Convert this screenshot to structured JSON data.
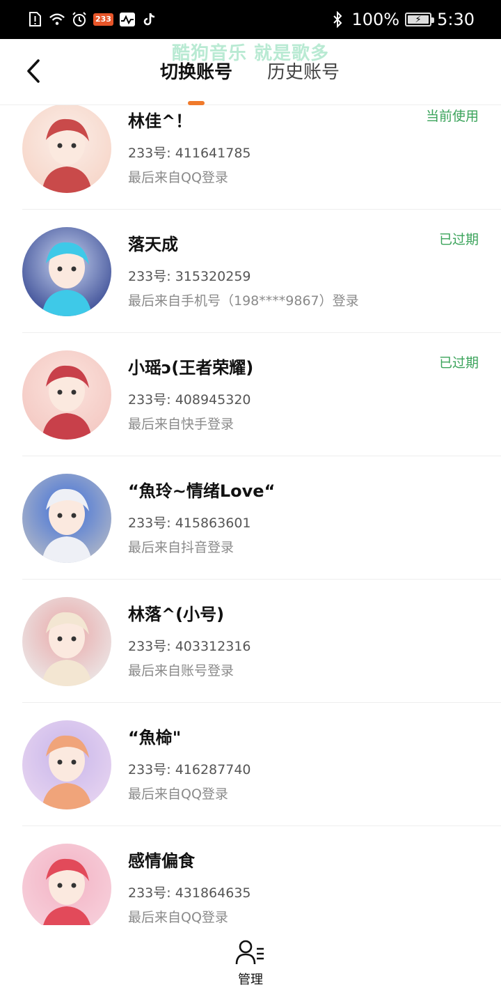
{
  "status_bar": {
    "badge_text": "233",
    "battery_text": "100%",
    "time": "5:30",
    "icons": [
      "sim-alert-icon",
      "wifi-icon",
      "alarm-icon",
      "app-233-icon",
      "health-icon",
      "tiktok-icon",
      "bluetooth-icon",
      "battery-charging-icon"
    ],
    "battery_level": 1.0
  },
  "header": {
    "watermark": "酷狗音乐 就是歌多",
    "back_icon": "chevron-left-icon",
    "tabs": [
      {
        "label": "切换账号",
        "active": true
      },
      {
        "label": "历史账号",
        "active": false
      }
    ],
    "accent_color": "#f07a2b"
  },
  "accounts": [
    {
      "name": "林佳^！",
      "id_line": "233号: 411641785",
      "login_line": "最后来自QQ登录",
      "status": "当前使用",
      "avatar_colors": [
        "#f6d3c5",
        "#c94a4a",
        "#fbeee8"
      ]
    },
    {
      "name": "落天成",
      "id_line": "233号: 315320259",
      "login_line": "最后来自手机号（198****9867）登录",
      "status": "已过期",
      "avatar_colors": [
        "#2d3f8c",
        "#3ec9e8",
        "#c8d4f0"
      ]
    },
    {
      "name": "小瑶ↄ(王者荣耀)",
      "id_line": "233号: 408945320",
      "login_line": "最后来自快手登录",
      "status": "已过期",
      "avatar_colors": [
        "#f3c6c0",
        "#c8404a",
        "#fbe3dd"
      ]
    },
    {
      "name": "“魚玲~情绪Love“",
      "id_line": "233号: 415863601",
      "login_line": "最后来自抖音登录",
      "status": "",
      "avatar_colors": [
        "#b8bcc6",
        "#eef0f6",
        "#3f6fd8"
      ]
    },
    {
      "name": "林落^(小号)",
      "id_line": "233号: 403312316",
      "login_line": "最后来自账号登录",
      "status": "",
      "avatar_colors": [
        "#ececec",
        "#f3e6d2",
        "#e8a7a7"
      ]
    },
    {
      "name": "“魚椧\"",
      "id_line": "233号: 416287740",
      "login_line": "最后来自QQ登录",
      "status": "",
      "avatar_colors": [
        "#e9d6f1",
        "#f0a47a",
        "#c8b6ea"
      ]
    },
    {
      "name": "感情偏食",
      "id_line": "233号: 431864635",
      "login_line": "最后来自QQ登录",
      "status": "",
      "avatar_colors": [
        "#f7d2dd",
        "#e24a5a",
        "#f3b3c4"
      ]
    }
  ],
  "bottom_bar": {
    "manage_label": "管理",
    "manage_icon": "user-manage-icon"
  }
}
